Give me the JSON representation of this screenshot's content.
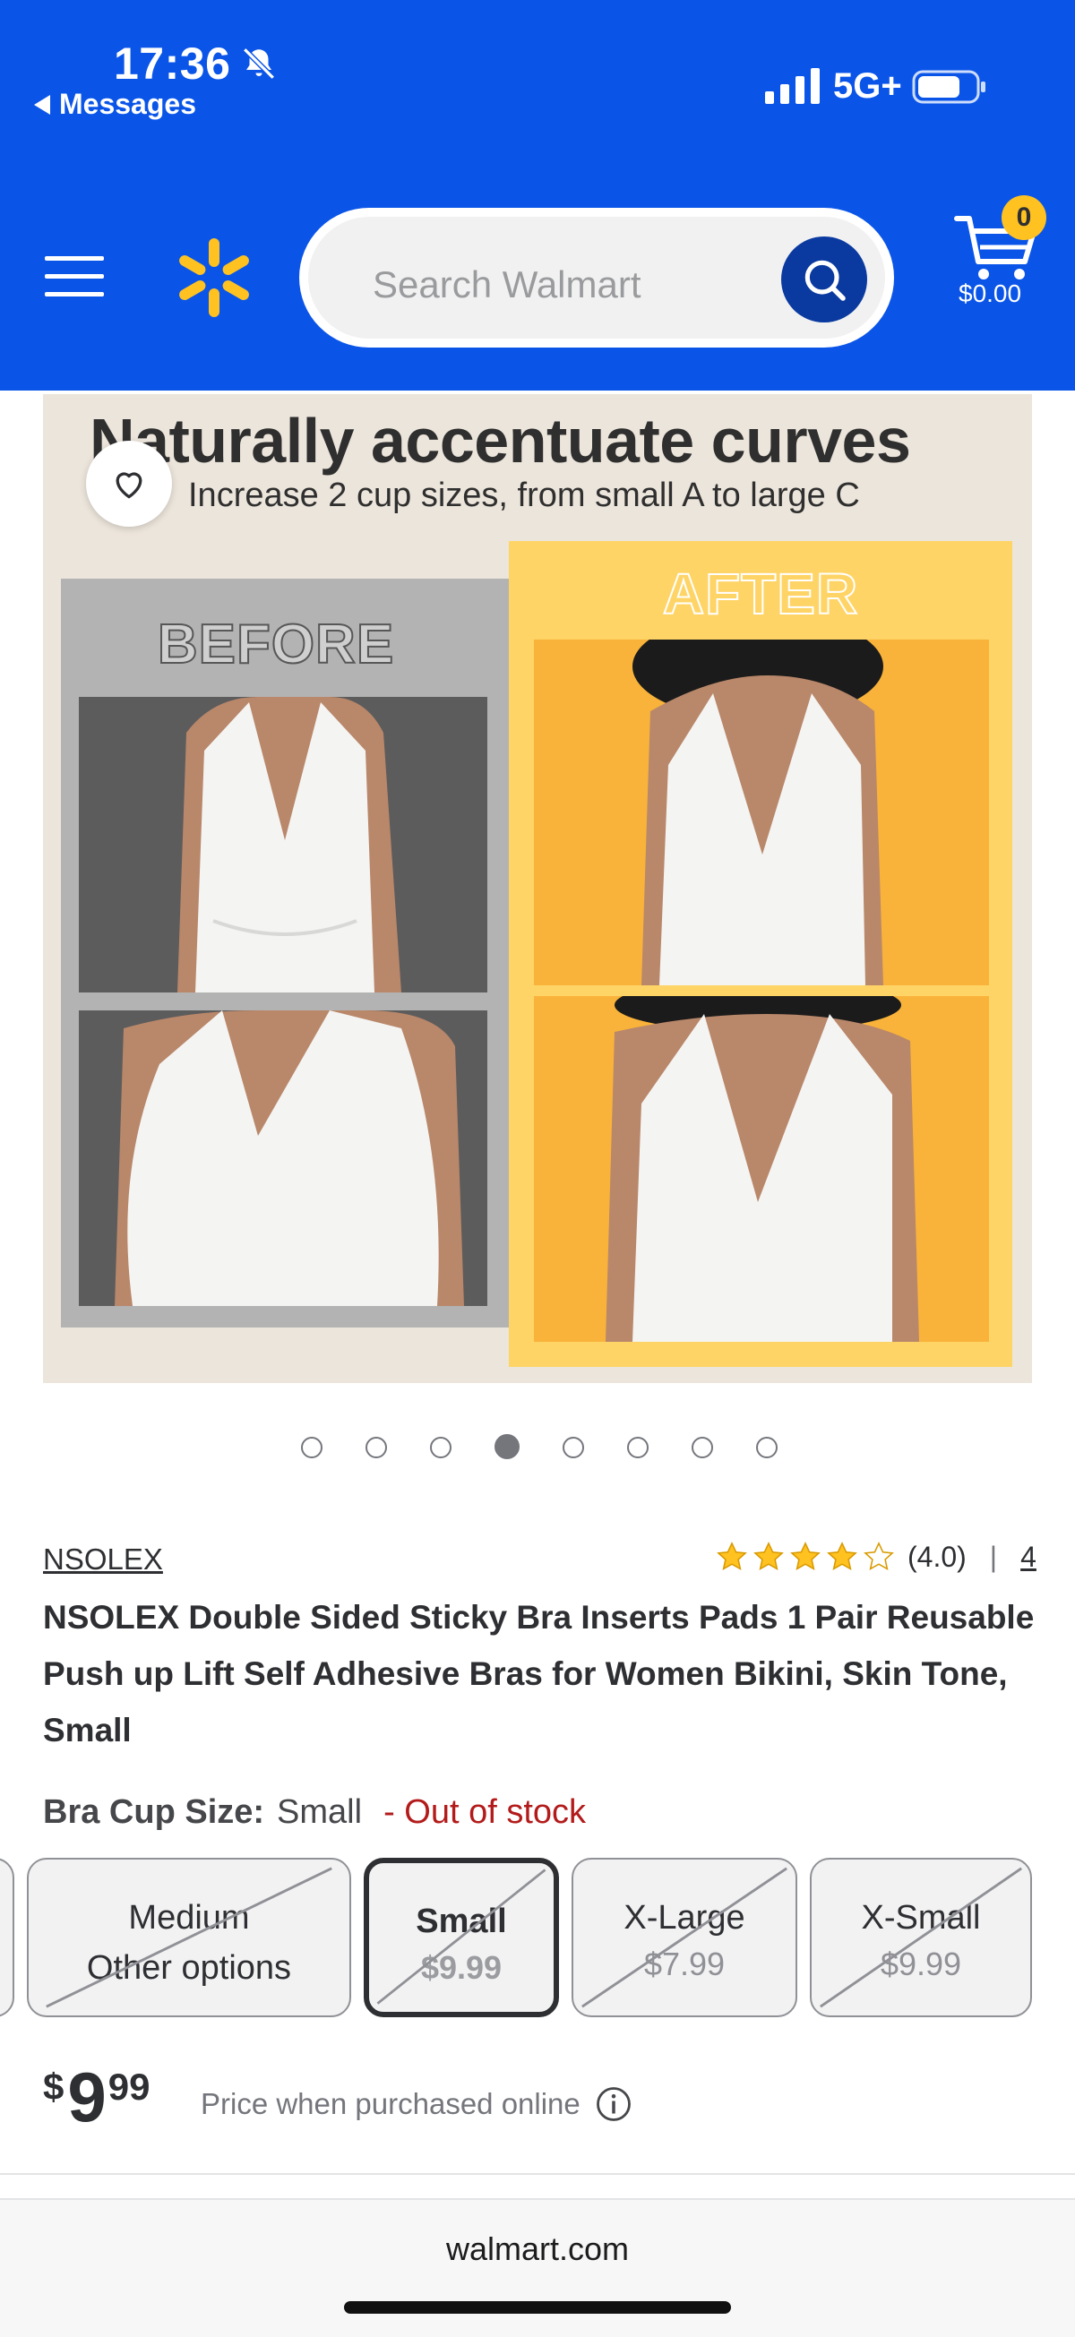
{
  "status_bar": {
    "time": "17:36",
    "back_label": "Messages",
    "network": "5G+",
    "icons": [
      "bell-slash-icon",
      "signal-icon",
      "battery-icon"
    ]
  },
  "header": {
    "search_placeholder": "Search Walmart",
    "cart_count": "0",
    "cart_total": "$0.00",
    "colors": {
      "header_bg": "#0a55e8",
      "spark": "#ffc220",
      "search_button": "#0a3aa0"
    },
    "icons": [
      "menu-icon",
      "spark-logo",
      "search-icon",
      "cart-icon"
    ]
  },
  "product_image": {
    "headline": "Naturally accentuate curves",
    "subline": "Increase 2 cup sizes, from small A to large C",
    "before_label": "BEFORE",
    "after_label": "AFTER"
  },
  "carousel": {
    "count": 8,
    "active_index": 3
  },
  "product": {
    "brand": "NSOLEX",
    "rating": 4.0,
    "rating_text": "(4.0)",
    "rating_separator": "|",
    "review_count": "4",
    "title": "NSOLEX Double Sided Sticky Bra Inserts Pads 1 Pair Reusable Push up Lift Self Adhesive Bras for Women Bikini, Skin Tone, Small",
    "variant_label": "Bra Cup Size:",
    "variant_value": "Small",
    "variant_stock": "- Out of stock",
    "options": [
      {
        "line1": "Medium",
        "line2": "Other options",
        "selected": false
      },
      {
        "line1": "Small",
        "line2": "$9.99",
        "selected": true
      },
      {
        "line1": "X-Large",
        "line2": "$7.99",
        "selected": false
      },
      {
        "line1": "X-Small",
        "line2": "$9.99",
        "selected": false
      }
    ],
    "price_currency": "$",
    "price_dollars": "9",
    "price_cents": "99",
    "price_note": "Price when purchased online"
  },
  "browser": {
    "url": "walmart.com"
  }
}
